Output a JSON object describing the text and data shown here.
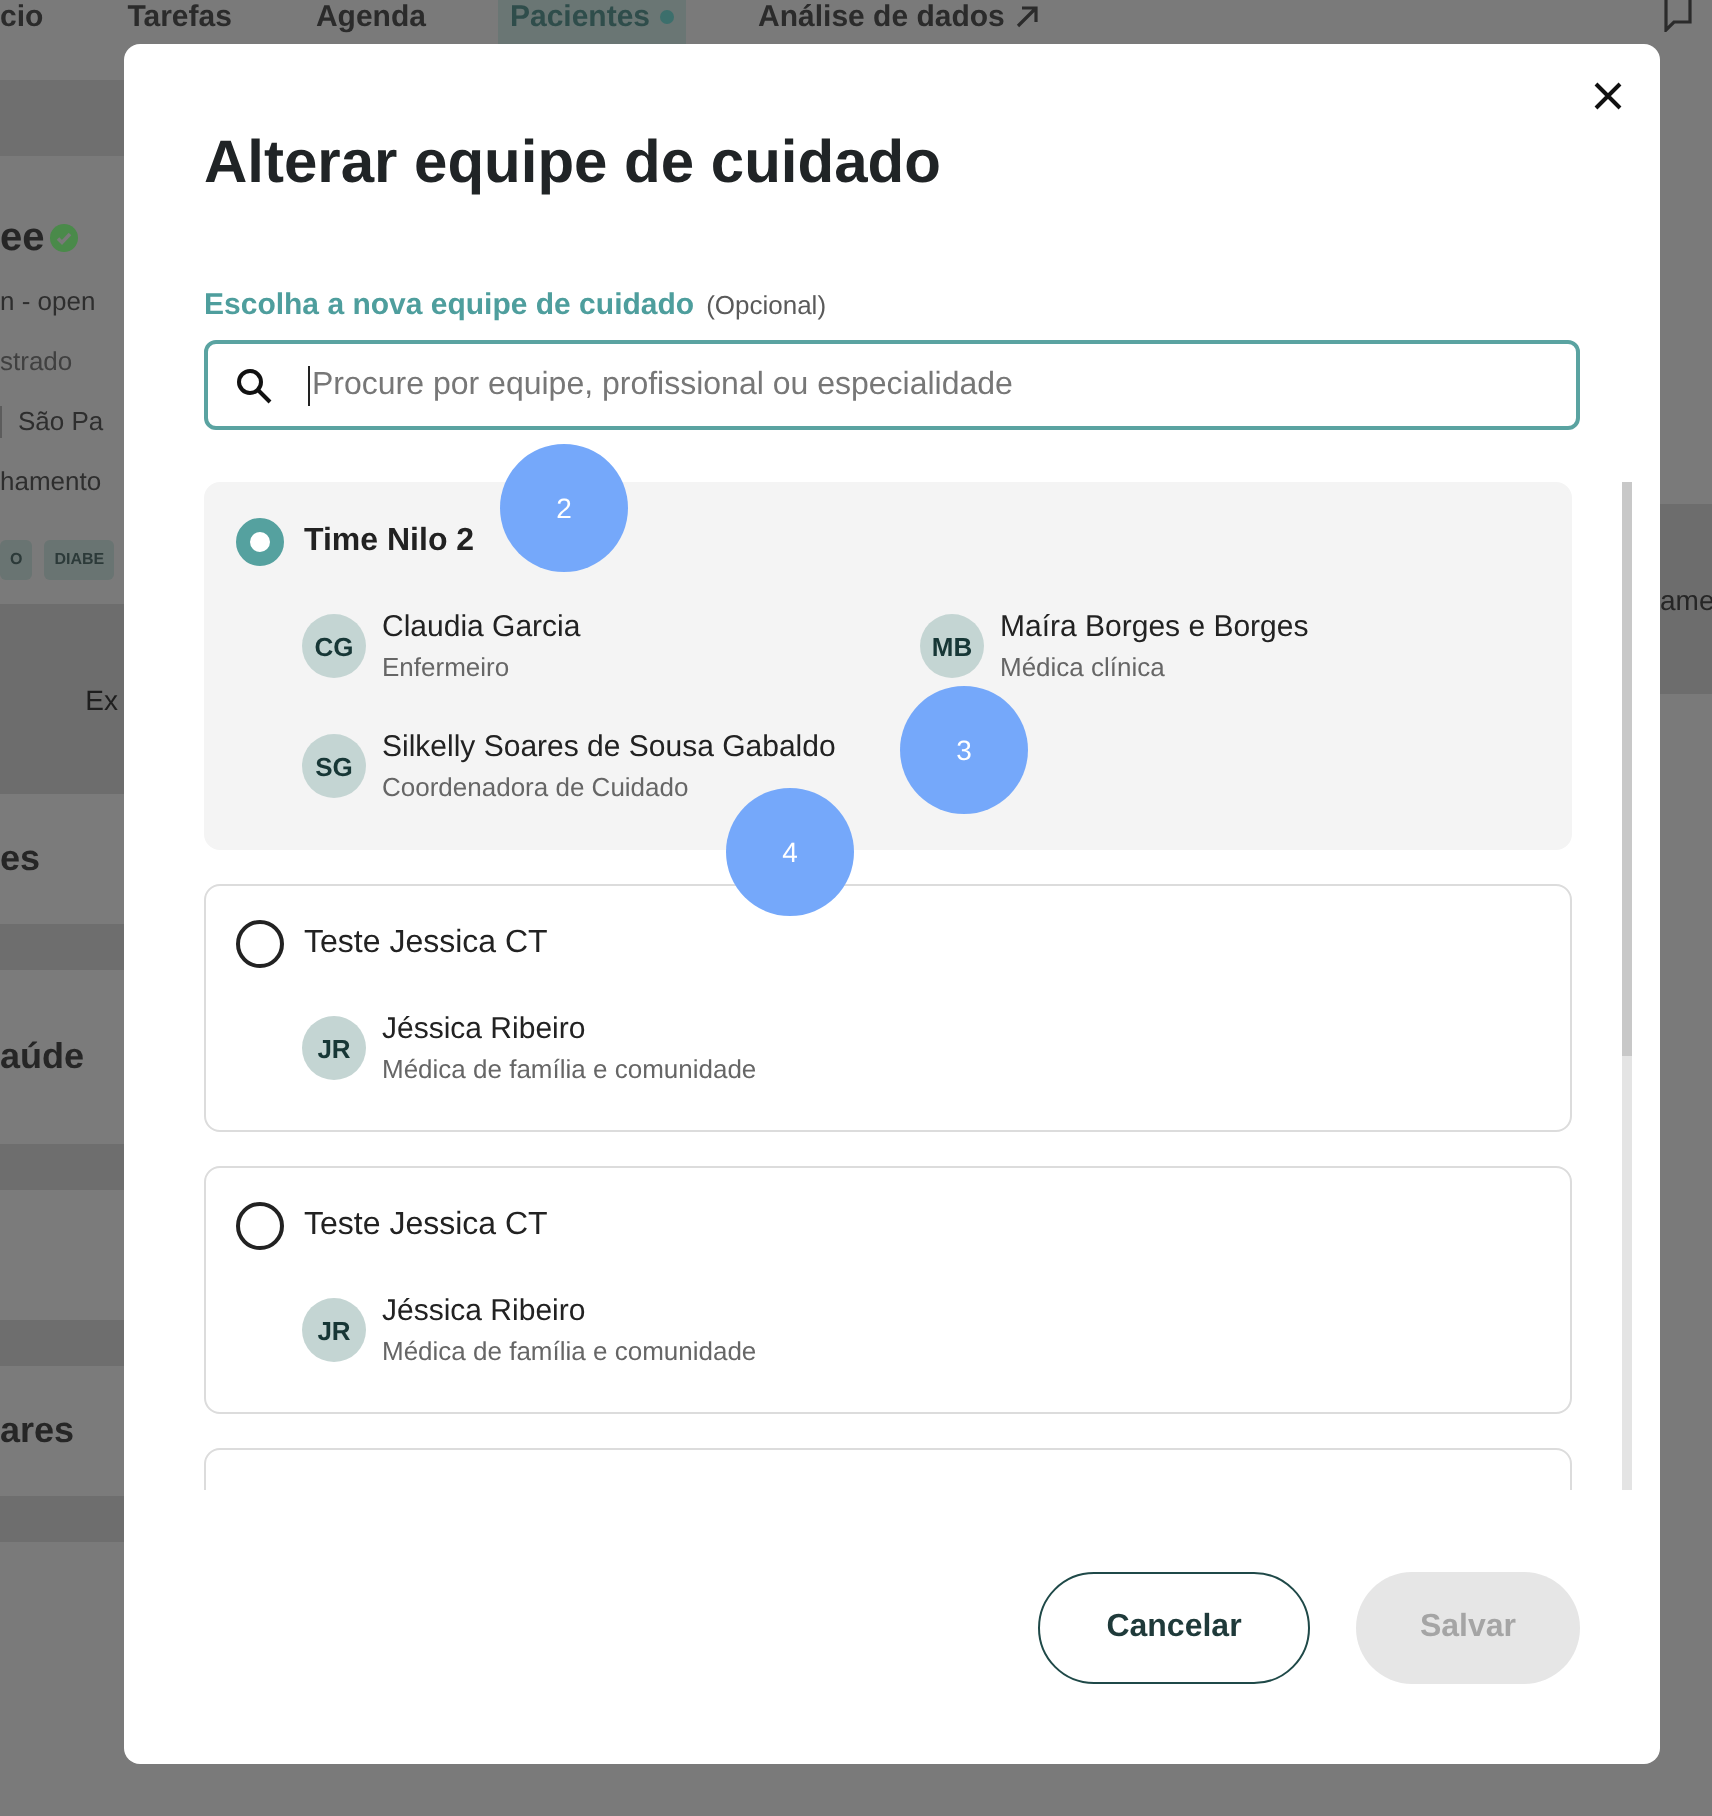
{
  "nav": {
    "items": [
      {
        "label": "cio",
        "selected": false
      },
      {
        "label": "Tarefas",
        "selected": false
      },
      {
        "label": "Agenda",
        "selected": false
      },
      {
        "label": "Pacientes",
        "selected": true
      },
      {
        "label": "Análise de dados",
        "selected": false,
        "external": true
      }
    ]
  },
  "background_page": {
    "left_column": [
      {
        "kind": "name",
        "text": "ee"
      },
      {
        "kind": "text",
        "text": "n - open"
      },
      {
        "kind": "muted",
        "text": "strado"
      },
      {
        "kind": "location",
        "text": "São Pa"
      },
      {
        "kind": "text",
        "text": "hamento"
      },
      {
        "kind": "tags",
        "tags": [
          "O",
          "DIABE"
        ]
      },
      {
        "kind": "band",
        "text": "Ex"
      },
      {
        "kind": "heading",
        "text": "es"
      },
      {
        "kind": "heading",
        "text": "aúde"
      },
      {
        "kind": "heading"
      },
      {
        "kind": "heading",
        "text": "ares"
      }
    ],
    "right_column": {
      "band_text": "ame"
    }
  },
  "modal": {
    "title": "Alterar equipe de cuidado",
    "field_label": "Escolha a nova equipe de cuidado",
    "field_hint": "(Opcional)",
    "search": {
      "placeholder": "Procure por equipe, profissional ou especialidade"
    },
    "teams": [
      {
        "name": "Time Nilo 2",
        "selected": true,
        "members": [
          {
            "initials": "CG",
            "name": "Claudia Garcia",
            "role": "Enfermeiro"
          },
          {
            "initials": "MB",
            "name": "Maíra Borges e Borges",
            "role": "Médica clínica"
          },
          {
            "initials": "SG",
            "name": "Silkelly Soares de Sousa Gabaldo",
            "role": "Coordenadora de Cuidado"
          }
        ]
      },
      {
        "name": "Teste Jessica CT",
        "selected": false,
        "members": [
          {
            "initials": "JR",
            "name": "Jéssica Ribeiro",
            "role": "Médica de família e comunidade"
          }
        ]
      },
      {
        "name": "Teste Jessica CT",
        "selected": false,
        "members": [
          {
            "initials": "JR",
            "name": "Jéssica Ribeiro",
            "role": "Médica de família e comunidade"
          }
        ]
      }
    ],
    "buttons": [
      {
        "label": "Cancelar",
        "disabled": false
      },
      {
        "label": "Salvar",
        "disabled": true
      }
    ]
  },
  "step_markers": [
    "2",
    "3",
    "4"
  ]
}
